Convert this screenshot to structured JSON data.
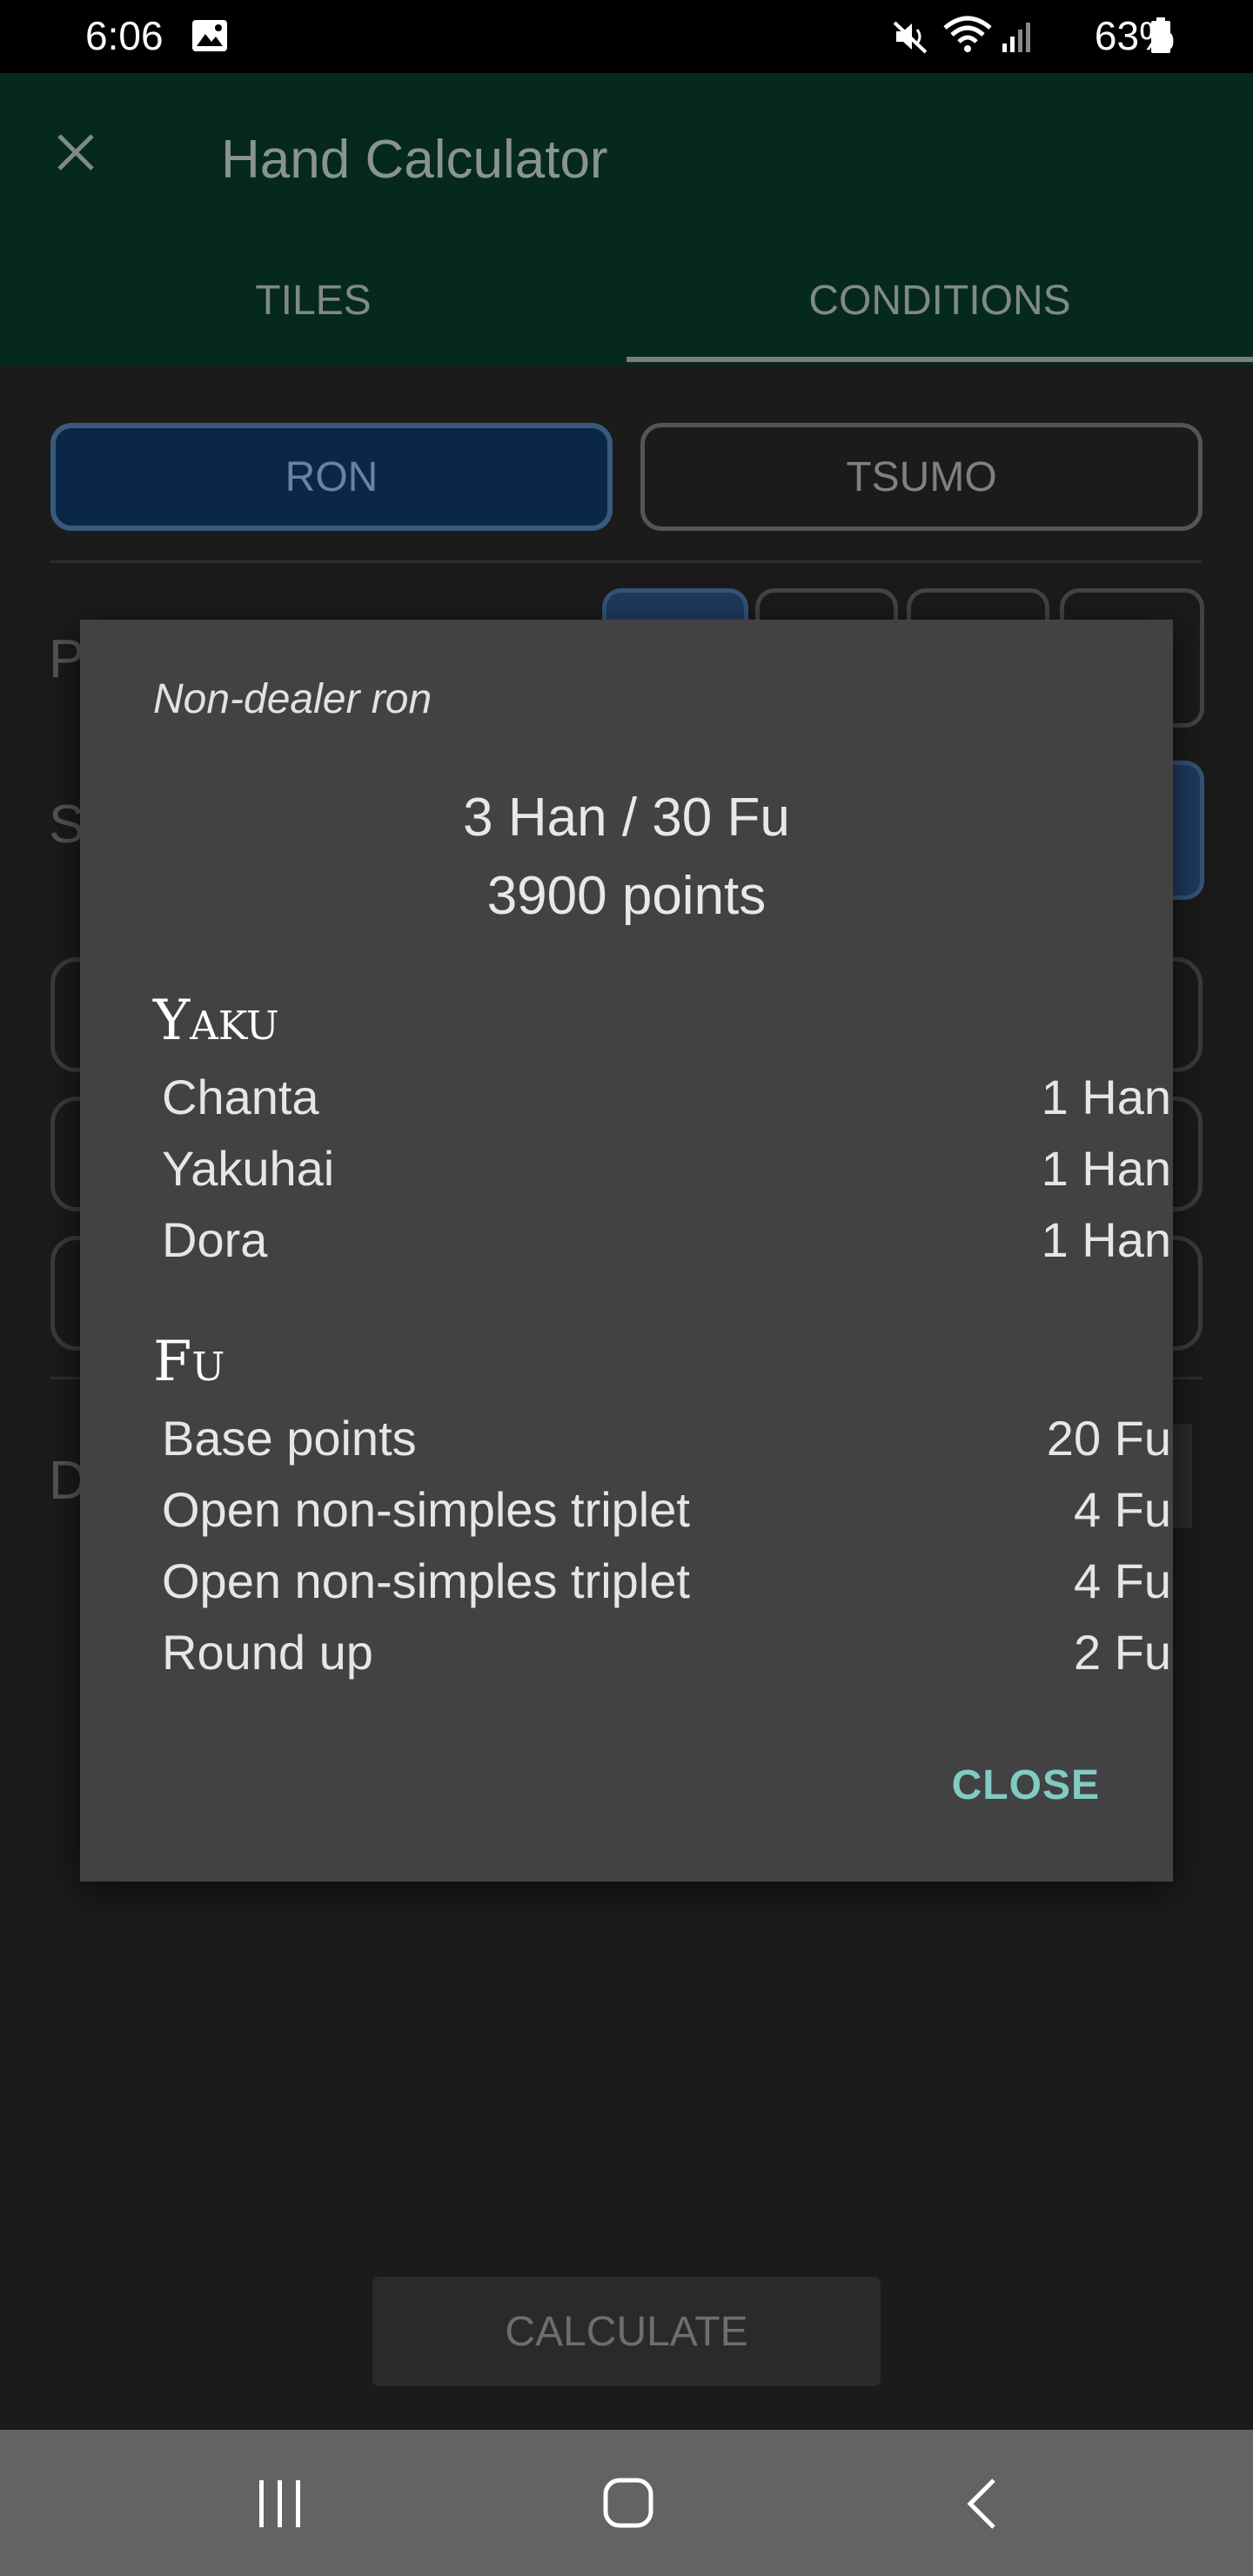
{
  "status_bar": {
    "time": "6:06",
    "battery": "63%"
  },
  "app_bar": {
    "title": "Hand Calculator",
    "tabs": [
      {
        "label": "TILES",
        "selected": false
      },
      {
        "label": "CONDITIONS",
        "selected": true
      }
    ]
  },
  "conditions": {
    "win_type": [
      "RON",
      "TSUMO"
    ],
    "selected_win_type": "RON"
  },
  "dialog": {
    "subtitle": "Non-dealer ron",
    "han_fu": "3 Han / 30 Fu",
    "points": "3900 points",
    "yaku_heading": "Yaku",
    "yaku": [
      {
        "name": "Chanta",
        "value": "1 Han"
      },
      {
        "name": "Yakuhai",
        "value": "1 Han"
      },
      {
        "name": "Dora",
        "value": "1 Han"
      }
    ],
    "fu_heading": "Fu",
    "fu": [
      {
        "name": "Base points",
        "value": "20 Fu"
      },
      {
        "name": "Open non-simples triplet",
        "value": "4 Fu"
      },
      {
        "name": "Open non-simples triplet",
        "value": "4 Fu"
      },
      {
        "name": "Round up",
        "value": "2 Fu"
      }
    ],
    "close_label": "CLOSE"
  },
  "calculate_label": "CALCULATE",
  "icons": {
    "close": "close-icon",
    "back": "back-icon",
    "home": "home-icon",
    "recents": "recents-icon"
  },
  "colors": {
    "app_bar": "#06291d",
    "dialog_bg": "#424242",
    "accent": "#80cbc4"
  }
}
